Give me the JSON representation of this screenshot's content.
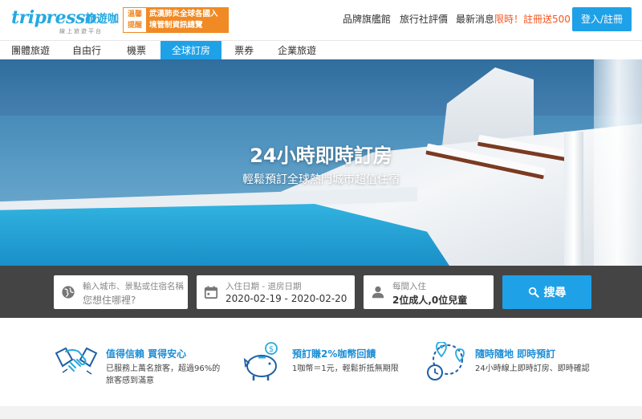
{
  "header": {
    "logo_text": "tripresso",
    "logo_cn": "旅遊咖",
    "logo_sub": "線上旅遊平台",
    "notice_tag": "溫馨提醒",
    "notice_text": "武漢肺炎全球各國入境管制資訊總覽",
    "links": {
      "brand": "品牌旗艦館",
      "review": "旅行社評價",
      "news_prefix": "最新消息",
      "news_highlight": "限時！註冊送500！"
    },
    "login_label": "登入/註冊"
  },
  "nav": {
    "items": [
      "團體旅遊",
      "自由行",
      "機票",
      "全球訂房",
      "票券",
      "企業旅遊"
    ],
    "active": "全球訂房"
  },
  "hero": {
    "title": "24小時即時訂房",
    "subtitle": "輕鬆預訂全球熱門城市超值住宿"
  },
  "search": {
    "destination": {
      "label": "輸入城市、景點或住宿名稱",
      "placeholder": "您想住哪裡?",
      "icon": "globe-icon"
    },
    "dates": {
      "label": "入住日期 - 退房日期",
      "value": "2020-02-19 - 2020-02-20",
      "icon": "calendar-icon"
    },
    "guests": {
      "label": "每間入住",
      "value": "2位成人,0位兒童",
      "icon": "person-icon"
    },
    "button_label": "搜尋"
  },
  "features": [
    {
      "title": "值得信賴 買得安心",
      "desc": "已服務上萬名旅客，超過96%的旅客感到滿意",
      "icon": "handshake-icon"
    },
    {
      "title": "預訂賺2%咖幣回饋",
      "desc": "1咖幣＝1元，輕鬆折抵無期限",
      "icon": "piggy-bank-icon"
    },
    {
      "title": "隨時隨地 即時預訂",
      "desc": "24小時線上即時訂房、即時確認",
      "icon": "location-clock-icon"
    }
  ],
  "colors": {
    "brand_blue": "#1fa1e8",
    "accent_orange": "#f08a24",
    "promo_red": "#f5551e",
    "search_bg": "#444444"
  }
}
